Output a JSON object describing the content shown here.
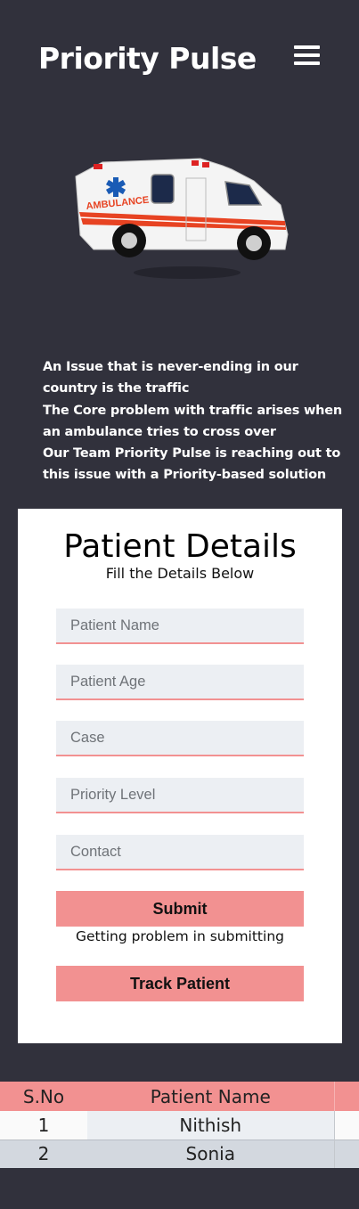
{
  "header": {
    "title": "Priority Pulse",
    "menu_icon": "hamburger-menu-icon"
  },
  "hero": {
    "image": "ambulance-illustration",
    "label": "AMBULANCE"
  },
  "intro": {
    "line1": "An Issue that is never-ending in our country is the traffic",
    "line2": "The Core problem with traffic arises when an ambulance tries to cross over",
    "line3": "Our Team Priority Pulse is reaching out to this issue with a Priority-based solution"
  },
  "form": {
    "title": "Patient Details",
    "subtitle": "Fill the Details Below",
    "fields": {
      "name_placeholder": "Patient Name",
      "age_placeholder": "Patient Age",
      "case_placeholder": "Case",
      "priority_placeholder": "Priority Level",
      "contact_placeholder": "Contact"
    },
    "submit_label": "Submit",
    "help_text": "Getting problem in submitting",
    "track_label": "Track Patient"
  },
  "table": {
    "headers": [
      "S.No",
      "Patient Name"
    ],
    "rows": [
      {
        "sno": "1",
        "name": "Nithish"
      },
      {
        "sno": "2",
        "name": "Sonia"
      }
    ]
  },
  "colors": {
    "background": "#31313c",
    "accent": "#f29191",
    "field_bg": "#eceff3"
  }
}
